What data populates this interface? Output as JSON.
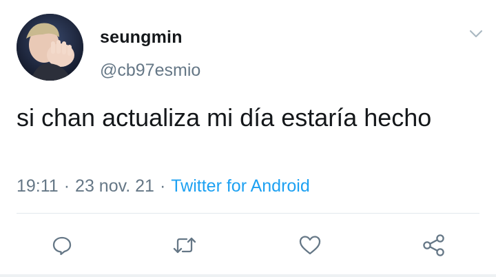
{
  "author": {
    "display_name": "seungmin",
    "handle": "@cb97esmio",
    "avatar_icon": "profile-photo"
  },
  "tweet": {
    "text": "si chan actualiza mi día estaría hecho"
  },
  "meta": {
    "time": "19:11",
    "date": "23 nov. 21",
    "separator": "·",
    "source": "Twitter for Android"
  },
  "actions": [
    {
      "name": "reply",
      "icon": "speech-bubble-icon"
    },
    {
      "name": "retweet",
      "icon": "retweet-arrows-icon"
    },
    {
      "name": "like",
      "icon": "heart-icon"
    },
    {
      "name": "share",
      "icon": "share-nodes-icon"
    }
  ],
  "colors": {
    "text": "#14171a",
    "secondary": "#657786",
    "link": "#1da1f2",
    "divider": "#e1e8ed"
  }
}
